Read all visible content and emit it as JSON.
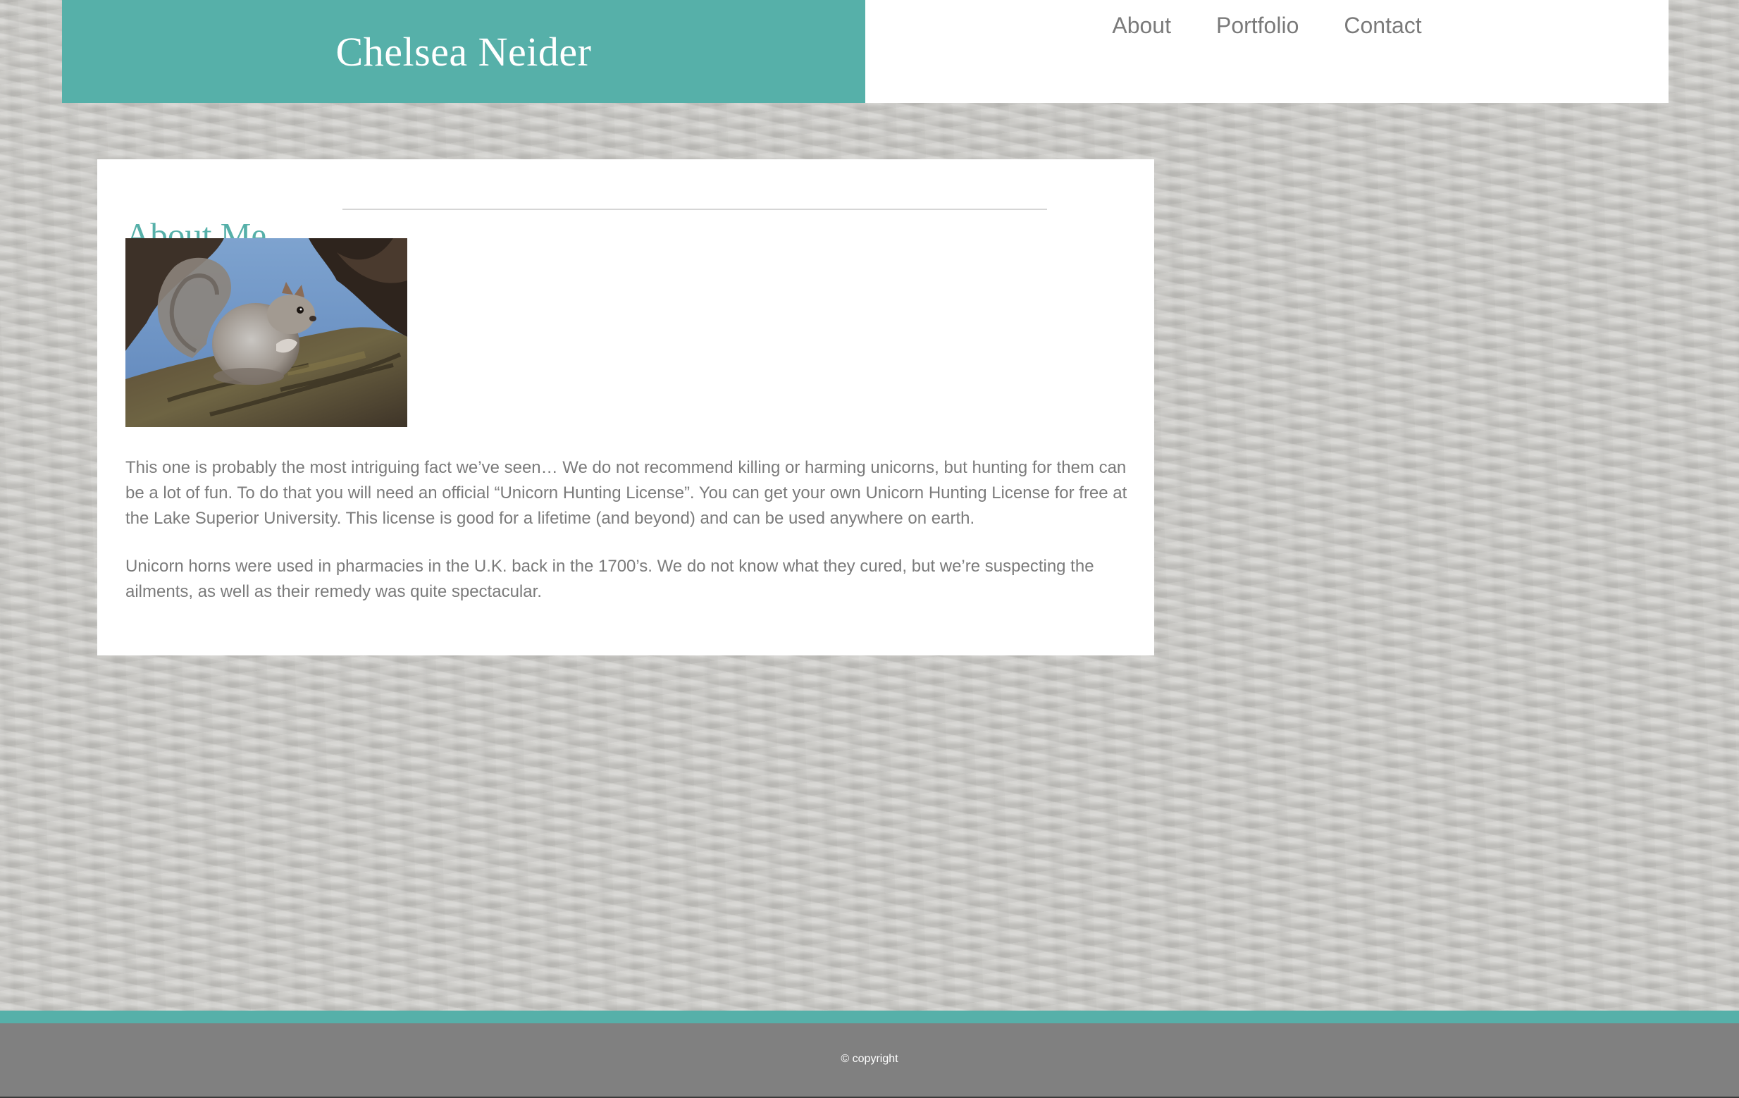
{
  "header": {
    "brand_title": "Chelsea Neider",
    "nav": [
      {
        "label": "About"
      },
      {
        "label": "Portfolio"
      },
      {
        "label": "Contact"
      }
    ]
  },
  "about": {
    "heading": "About Me",
    "photo_alt": "Gray squirrel sitting on a tree branch",
    "paragraphs": [
      "This one is probably the most intriguing fact we’ve seen… We do not recommend killing or harming unicorns, but hunting for them can be a lot of fun. To do that you will need an official “Unicorn Hunting License”. You can get your own Unicorn Hunting License for free at the Lake Superior University. This license is good for a lifetime (and beyond) and can be used anywhere on earth.",
      "Unicorn horns were used in pharmacies in the U.K. back in the 1700’s. We do not know what they cured, but we’re suspecting the ailments, as well as their remedy was quite spectacular."
    ]
  },
  "footer": {
    "copyright": "© copyright"
  },
  "colors": {
    "accent_teal": "#56b0a9",
    "footer_gray": "#808080",
    "text_gray": "#7b7b7b"
  }
}
